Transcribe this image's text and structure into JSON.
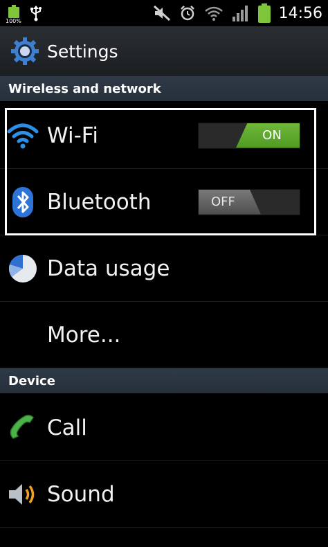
{
  "status_bar": {
    "battery_percent_text": "100%",
    "time": "14:56",
    "icons": [
      "battery-icon",
      "usb-icon",
      "mute-icon",
      "alarm-icon",
      "wifi-signal-icon",
      "cell-signal-icon",
      "battery-full-icon"
    ]
  },
  "title_bar": {
    "title": "Settings",
    "icon": "settings-gear-icon"
  },
  "sections": [
    {
      "header": "Wireless and network",
      "items": [
        {
          "label": "Wi-Fi",
          "icon": "wifi-icon",
          "toggle": "ON"
        },
        {
          "label": "Bluetooth",
          "icon": "bluetooth-icon",
          "toggle": "OFF"
        },
        {
          "label": "Data usage",
          "icon": "pie-chart-icon"
        },
        {
          "label": "More..."
        }
      ]
    },
    {
      "header": "Device",
      "items": [
        {
          "label": "Call",
          "icon": "phone-icon"
        },
        {
          "label": "Sound",
          "icon": "speaker-icon"
        }
      ]
    }
  ],
  "colors": {
    "toggle_on": "#5aa62c",
    "section_header": "#2b3540",
    "highlight_border": "#ffffff"
  }
}
